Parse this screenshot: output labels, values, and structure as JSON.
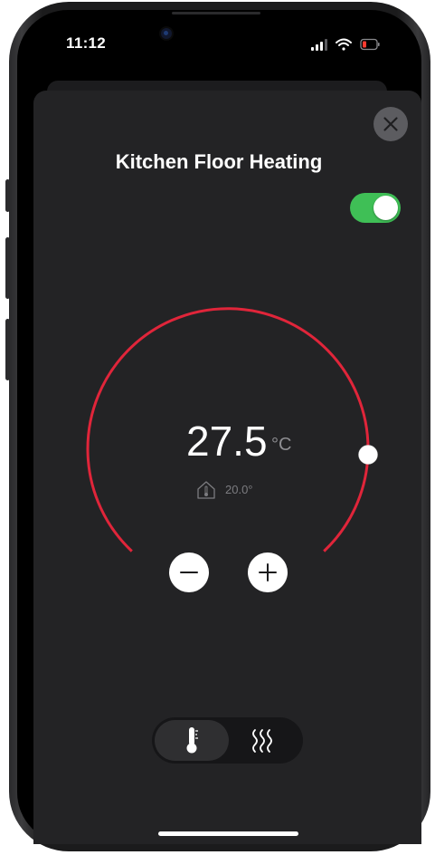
{
  "status_bar": {
    "time": "11:12",
    "icons": [
      "signal-icon",
      "wifi-icon",
      "battery-low-icon"
    ]
  },
  "device": {
    "title": "Kitchen Floor Heating",
    "power_on": true
  },
  "thermostat": {
    "setpoint": "27.5",
    "unit": "°C",
    "indoor_temperature": "20.0°",
    "arc_color": "#e0253a",
    "toggle_color": "#3fbf56"
  },
  "controls": {
    "decrease_icon": "minus-icon",
    "increase_icon": "plus-icon",
    "close_icon": "close-icon"
  },
  "mode_switch": {
    "options": [
      {
        "icon": "thermometer-icon",
        "selected": true
      },
      {
        "icon": "heat-waves-icon",
        "selected": false
      }
    ]
  }
}
